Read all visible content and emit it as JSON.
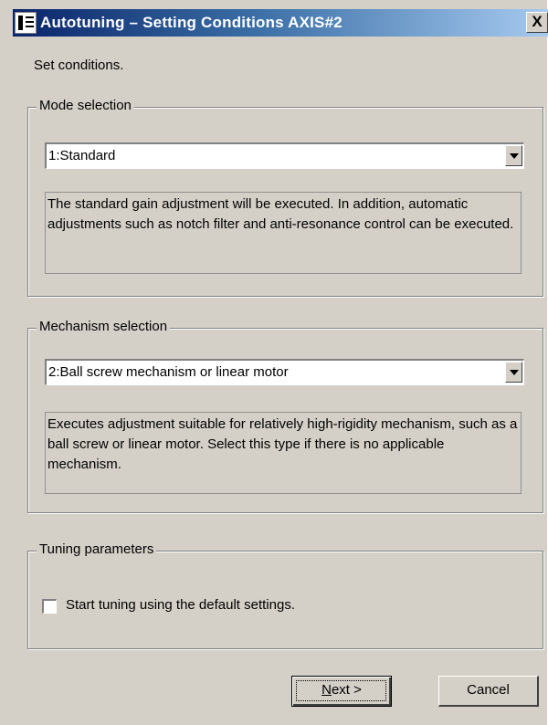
{
  "window": {
    "title": "Autotuning – Setting Conditions AXIS#2",
    "close_label": "X"
  },
  "prompt": "Set conditions.",
  "mode": {
    "legend": "Mode selection",
    "selected": "1:Standard",
    "description": "The standard gain adjustment will be executed. In addition, automatic adjustments such as notch filter and anti-resonance control can be executed."
  },
  "mechanism": {
    "legend": "Mechanism selection",
    "selected": "2:Ball screw mechanism or linear motor",
    "description": "Executes adjustment suitable for relatively high-rigidity mechanism, such as a ball screw or linear motor. Select this type if there is no applicable mechanism."
  },
  "tuning": {
    "legend": "Tuning parameters",
    "checkbox_label": "Start tuning using the default settings.",
    "checked": false
  },
  "buttons": {
    "next_mnemonic": "N",
    "next_rest": "ext >",
    "cancel": "Cancel"
  },
  "icons": [
    "app-icon",
    "close-icon",
    "dropdown-arrow-icon"
  ]
}
